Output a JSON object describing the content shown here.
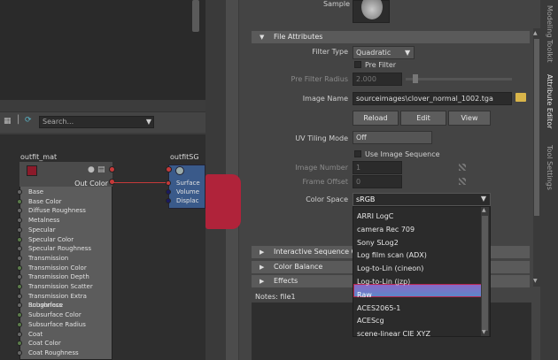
{
  "node_editor": {
    "search_placeholder": "Search...",
    "material_node": {
      "title": "outfit_mat",
      "output_label": "Out Color",
      "ports": [
        "Base",
        "Base Color",
        "Diffuse Roughness",
        "Metalness",
        "Specular",
        "Specular Color",
        "Specular Roughness",
        "Transmission",
        "Transmission Color",
        "Transmission Depth",
        "Transmission Scatter",
        "Transmission Extra Roughness",
        "Subsurface",
        "Subsurface Color",
        "Subsurface Radius",
        "Coat",
        "Coat Color",
        "Coat Roughness"
      ]
    },
    "sg_node": {
      "title": "outfitSG",
      "ports": [
        "Surface",
        "Volume",
        "Displac"
      ]
    }
  },
  "attribute_editor": {
    "sample_label": "Sample",
    "file_attributes_header": "File Attributes",
    "filter_type_label": "Filter Type",
    "filter_type_value": "Quadratic",
    "pre_filter_label": "Pre Filter",
    "pre_filter_radius_label": "Pre Filter Radius",
    "pre_filter_radius_value": "2.000",
    "image_name_label": "Image Name",
    "image_name_value": "sourceimages\\clover_normal_1002.tga",
    "reload_label": "Reload",
    "edit_label": "Edit",
    "view_label": "View",
    "uv_tiling_label": "UV Tiling Mode",
    "uv_tiling_value": "Off",
    "use_image_sequence_label": "Use Image Sequence",
    "image_number_label": "Image Number",
    "image_number_value": "1",
    "frame_offset_label": "Frame Offset",
    "frame_offset_value": "0",
    "color_space_label": "Color Space",
    "color_space_value": "sRGB",
    "color_space_options": [
      "ARRI LogC",
      "camera Rec 709",
      "Sony SLog2",
      "Log film scan (ADX)",
      "Log-to-Lin (cineon)",
      "Log-to-Lin (jzp)",
      "Raw",
      "ACES2065-1",
      "ACEScg",
      "scene-linear CIE XYZ"
    ],
    "highlighted_option": "Raw",
    "sections": [
      "Interactive Sequence Ca",
      "Color Balance",
      "Effects"
    ],
    "notes_label": "Notes:  file1"
  },
  "right_tabs": [
    "Modeling Toolkit",
    "Attribute Editor",
    "Tool Settings"
  ],
  "colors": {
    "highlight_top": "#8a69c8",
    "highlight_bottom": "#5c87c8",
    "highlight_border": "#b82850",
    "material_swatch": "#8b1a2a",
    "sg_node": "#3a5a8a"
  }
}
